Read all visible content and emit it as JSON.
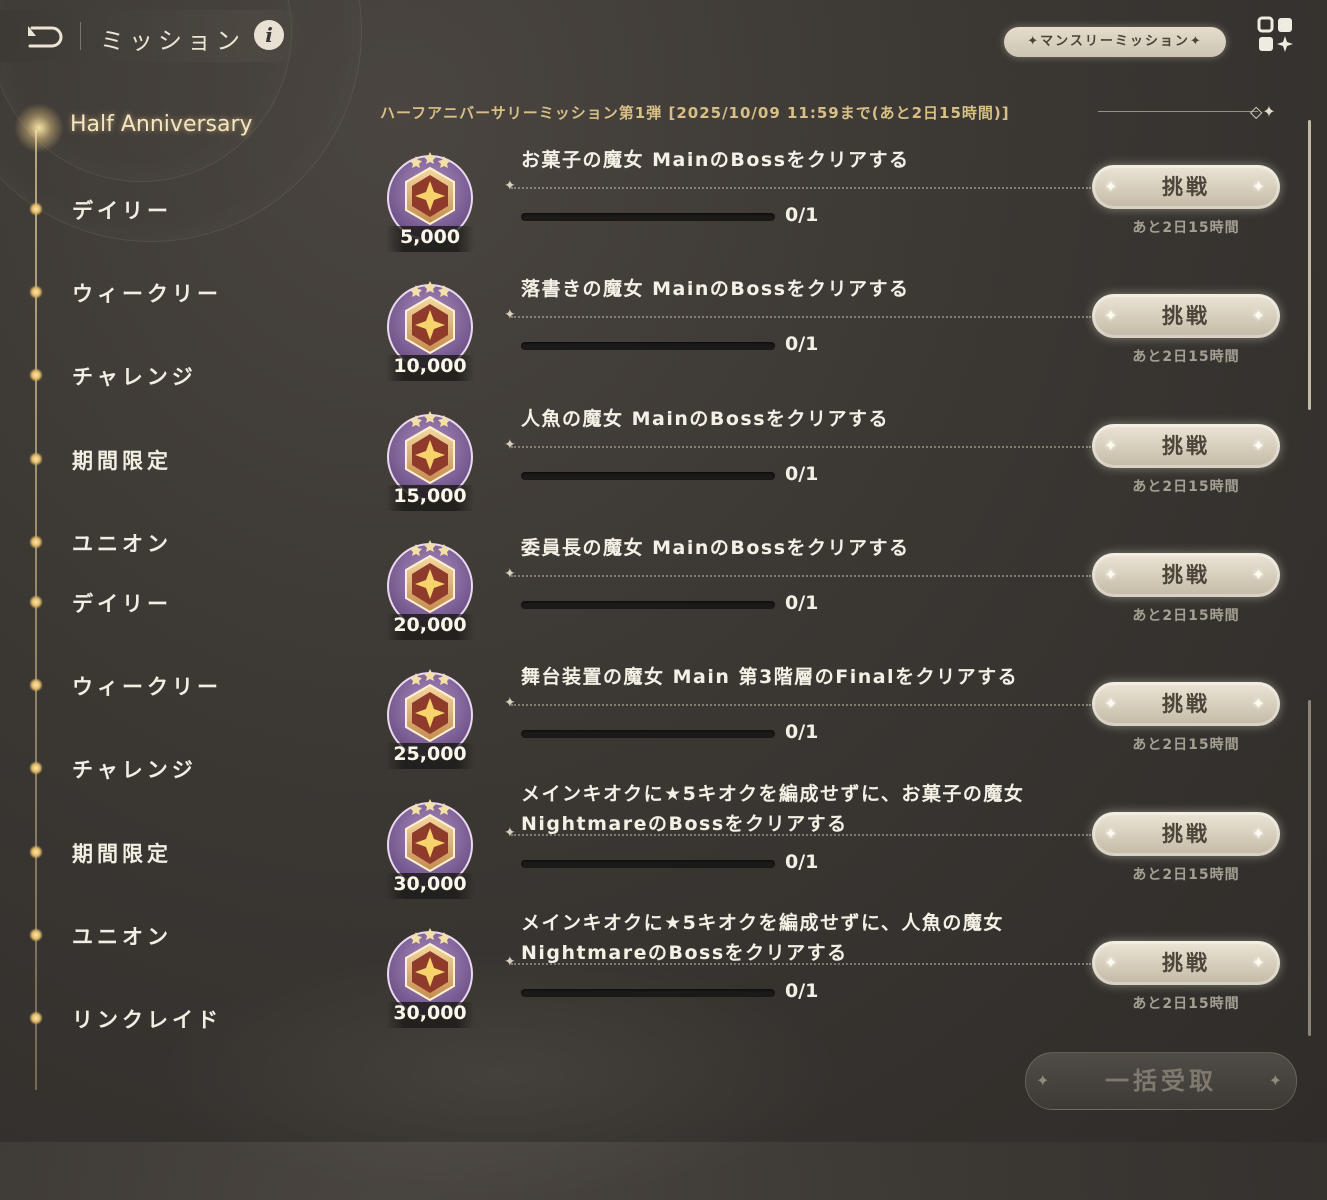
{
  "header": {
    "title": "ミッション",
    "info_label": "i",
    "monthly_button": "✦マンスリーミッション✦",
    "back_icon": "back-arrow-icon",
    "menu_icon": "grid-menu-icon"
  },
  "sidebar": {
    "active": "Half Anniversary",
    "items": [
      {
        "label": "デイリー"
      },
      {
        "label": "ウィークリー"
      },
      {
        "label": "チャレンジ"
      },
      {
        "label": "期間限定"
      },
      {
        "label": "ユニオン"
      },
      {
        "label": "デイリー"
      },
      {
        "label": "ウィークリー"
      },
      {
        "label": "チャレンジ"
      },
      {
        "label": "期間限定"
      },
      {
        "label": "ユニオン"
      },
      {
        "label": "リンクレイド"
      }
    ]
  },
  "event": {
    "header": "ハーフアニバーサリーミッション第1弾 [2025/10/09 11:59まで(あと2日15時間)]"
  },
  "missions": [
    {
      "reward": "5,000",
      "title": "お菓子の魔女 MainのBossをクリアする",
      "progress": "0/1",
      "progress_fraction": 0,
      "button": "挑戦",
      "time_left": "あと2日15時間"
    },
    {
      "reward": "10,000",
      "title": "落書きの魔女 MainのBossをクリアする",
      "progress": "0/1",
      "progress_fraction": 0,
      "button": "挑戦",
      "time_left": "あと2日15時間"
    },
    {
      "reward": "15,000",
      "title": "人魚の魔女 MainのBossをクリアする",
      "progress": "0/1",
      "progress_fraction": 0,
      "button": "挑戦",
      "time_left": "あと2日15時間"
    },
    {
      "reward": "20,000",
      "title": "委員長の魔女 MainのBossをクリアする",
      "progress": "0/1",
      "progress_fraction": 0,
      "button": "挑戦",
      "time_left": "あと2日15時間"
    },
    {
      "reward": "25,000",
      "title": "舞台装置の魔女 Main 第3階層のFinalをクリアする",
      "progress": "0/1",
      "progress_fraction": 0,
      "button": "挑戦",
      "time_left": "あと2日15時間"
    },
    {
      "reward": "30,000",
      "title": "メインキオクに★5キオクを編成せずに、お菓子の魔女 NightmareのBossをクリアする",
      "progress": "0/1",
      "progress_fraction": 0,
      "button": "挑戦",
      "time_left": "あと2日15時間"
    },
    {
      "reward": "30,000",
      "title": "メインキオクに★5キオクを編成せずに、人魚の魔女 NightmareのBossをクリアする",
      "progress": "0/1",
      "progress_fraction": 0,
      "button": "挑戦",
      "time_left": "あと2日15時間"
    }
  ],
  "bulk_claim": "一括受取",
  "colors": {
    "accent_gold": "#d8bf86",
    "medal_purple": "#8a6aa0",
    "medal_bronze": "#b5654a",
    "button_cream": "#e4ddcc"
  }
}
